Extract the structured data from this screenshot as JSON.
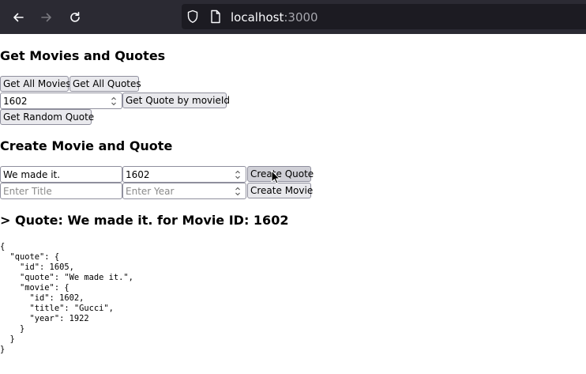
{
  "browser": {
    "url_host": "localhost",
    "url_port": ":3000"
  },
  "get_section": {
    "title": "Get Movies and Quotes",
    "get_all_movies_label": "Get All Movies",
    "get_all_quotes_label": "Get All Quotes",
    "movie_id_value": "1602",
    "get_quote_by_movie_label": "Get Quote by movieId",
    "get_random_quote_label": "Get Random Quote"
  },
  "create_section": {
    "title": "Create Movie and Quote",
    "quote_value": "We made it.",
    "quote_movie_id_value": "1602",
    "create_quote_label": "Create Quote",
    "title_placeholder": "Enter Title",
    "year_placeholder": "Enter Year",
    "create_movie_label": "Create Movie"
  },
  "result": {
    "heading": "> Quote: We made it. for Movie ID: 1602",
    "json_output": "{\n  \"quote\": {\n    \"id\": 1605,\n    \"quote\": \"We made it.\",\n    \"movie\": {\n      \"id\": 1602,\n      \"title\": \"Gucci\",\n      \"year\": 1922\n    }\n  }\n}"
  }
}
